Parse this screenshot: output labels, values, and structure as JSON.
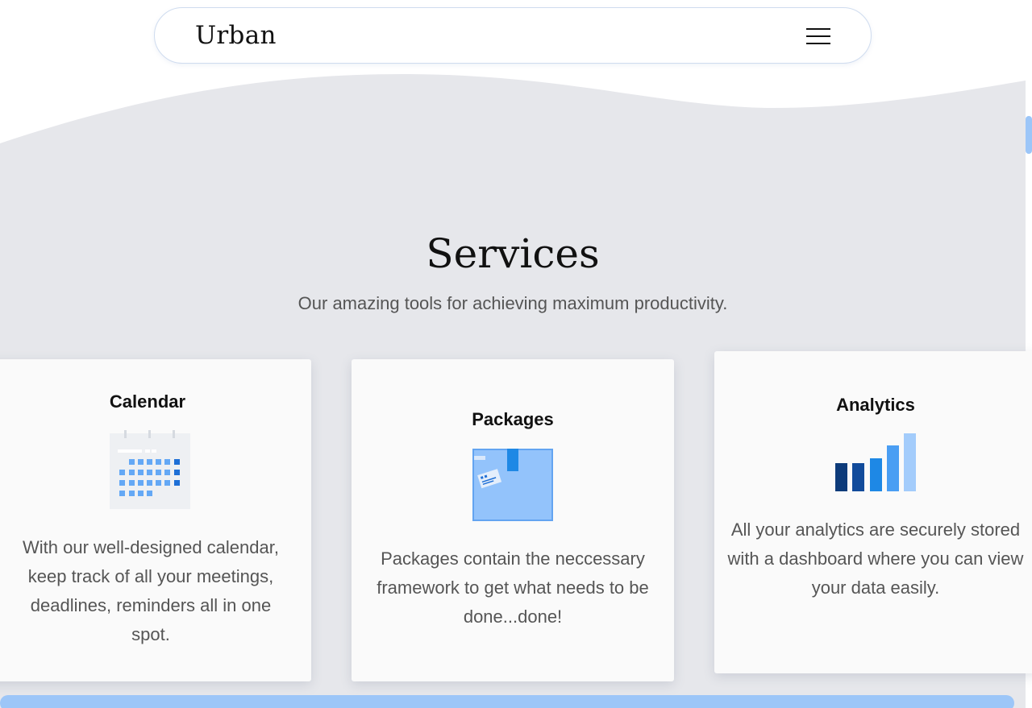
{
  "brand": {
    "name": "Urban"
  },
  "services": {
    "title": "Services",
    "subtitle": "Our amazing tools for achieving maximum productivity.",
    "cards": [
      {
        "title": "Calendar",
        "icon": "calendar-icon",
        "text": "With our well-designed calendar, keep track of all your meetings, deadlines, reminders all in one spot."
      },
      {
        "title": "Packages",
        "icon": "package-box-icon",
        "text": "Packages contain the neccessary framework to get what needs to be done...done!"
      },
      {
        "title": "Analytics",
        "icon": "bar-chart-icon",
        "text": "All your analytics are securely stored with a dashboard where you can view your data easily."
      }
    ]
  },
  "colors": {
    "section_bg": "#e6e7eb",
    "accent_light": "#9cc6f8",
    "accent": "#1e88e5",
    "accent_dark": "#0d3b7a"
  }
}
